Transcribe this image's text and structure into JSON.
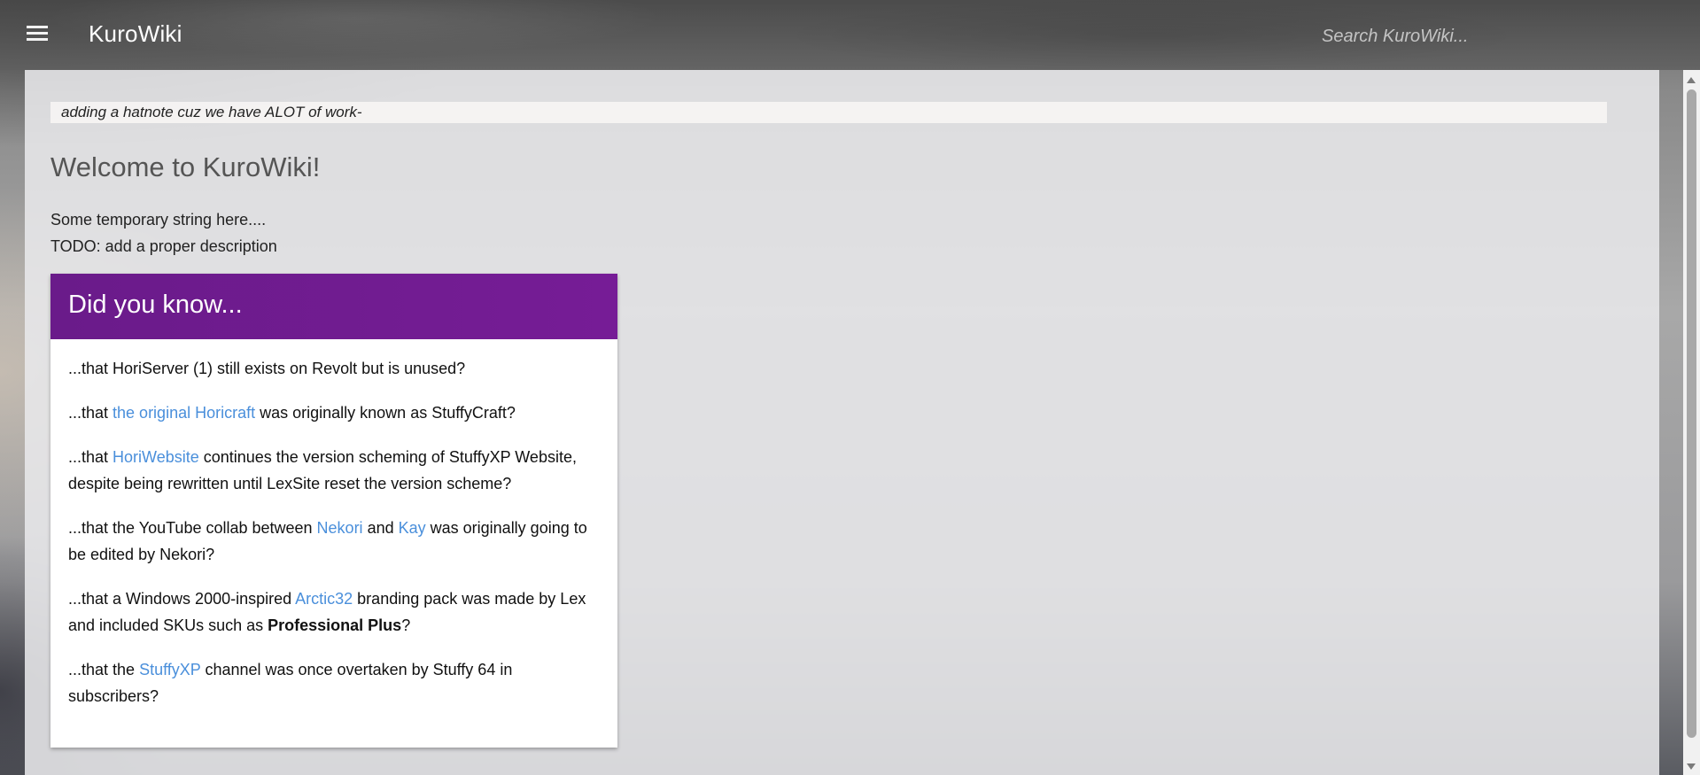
{
  "header": {
    "brand": "KuroWiki",
    "search_placeholder": "Search KuroWiki..."
  },
  "hatnote": "adding a hatnote cuz we have ALOT of work-",
  "page_title": "Welcome to KuroWiki!",
  "intro": {
    "line1": "Some temporary string here....",
    "line2": "TODO: add a proper description"
  },
  "did_you_know": {
    "title": "Did you know...",
    "facts": [
      {
        "text": "...that HoriServer (1) still exists on Revolt but is unused?"
      },
      {
        "before": "...that ",
        "link": "the original Horicraft",
        "after": " was originally known as StuffyCraft?"
      },
      {
        "before": "...that ",
        "link": "HoriWebsite",
        "after": " continues the version scheming of StuffyXP Website, despite being rewritten until LexSite reset the version scheme?"
      },
      {
        "before": "...that the YouTube collab between ",
        "link1": "Nekori",
        "middle": " and ",
        "link2": "Kay",
        "after": " was originally going to be edited by Nekori?"
      },
      {
        "before": "...that a Windows 2000-inspired ",
        "link": "Arctic32",
        "middle": " branding pack was made by Lex and included SKUs such as ",
        "bold": "Professional Plus",
        "after": "?"
      },
      {
        "before": "...that the ",
        "link": "StuffyXP",
        "after": " channel was once overtaken by Stuffy 64 in subscribers?"
      }
    ]
  },
  "colors": {
    "dyk_header": "#6f1b8f",
    "link": "#4a8fdb"
  },
  "icons": {
    "menu": "hamburger-menu-icon"
  }
}
